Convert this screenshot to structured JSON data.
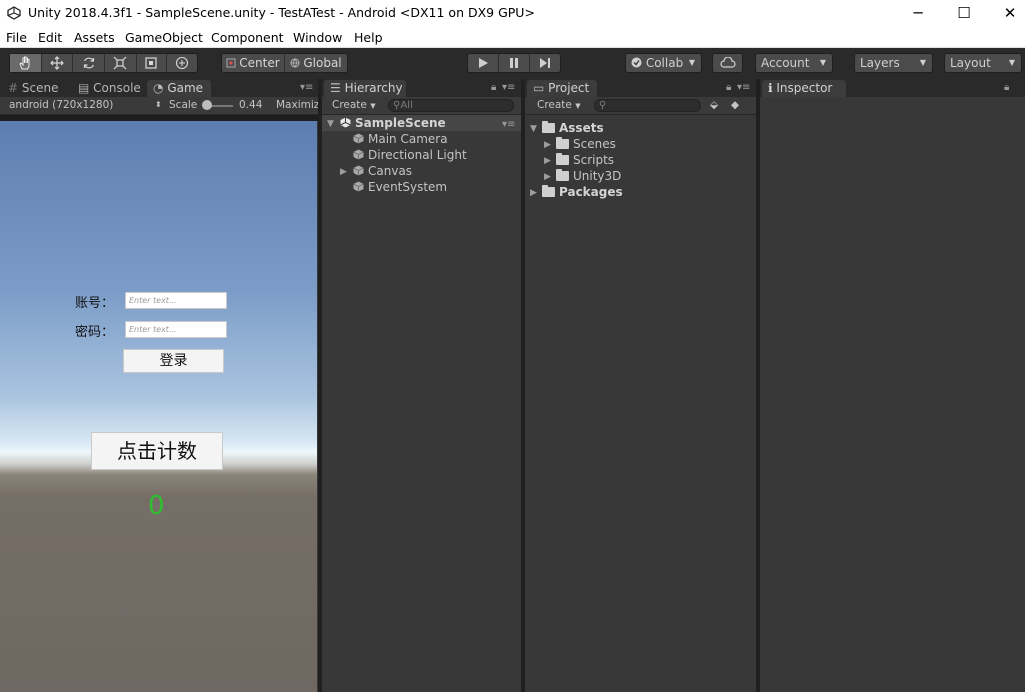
{
  "window": {
    "title": "Unity 2018.4.3f1 - SampleScene.unity - TestATest - Android <DX11 on DX9 GPU>",
    "minimize_glyph": "─",
    "maximize_glyph": "☐",
    "close_glyph": "✕"
  },
  "menu": [
    "File",
    "Edit",
    "Assets",
    "GameObject",
    "Component",
    "Window",
    "Help"
  ],
  "toolbar": {
    "pivot_label": "Center",
    "space_label": "Global",
    "collab_label": "Collab",
    "account_label": "Account",
    "layers_label": "Layers",
    "layout_label": "Layout"
  },
  "scene_panel": {
    "tabs": [
      "Scene",
      "Console",
      "Game"
    ],
    "active_tab": "Game",
    "resolution": "android (720x1280)",
    "scale_label": "Scale",
    "scale_value": "0.44",
    "maximize_label": "Maximiz"
  },
  "game": {
    "account_label": "账号：",
    "account_placeholder": "Enter text...",
    "password_label": "密码：",
    "password_placeholder": "Enter text...",
    "login_button": "登录",
    "count_button": "点击计数",
    "count_value": "0",
    "count_color": "#2fbf2f"
  },
  "hierarchy": {
    "tab": "Hierarchy",
    "create_label": "Create",
    "search_placeholder": "All",
    "scene_name": "SampleScene",
    "items": [
      "Main Camera",
      "Directional Light",
      "Canvas",
      "EventSystem"
    ]
  },
  "project": {
    "tab": "Project",
    "create_label": "Create",
    "root_assets": "Assets",
    "asset_folders": [
      "Scenes",
      "Scripts",
      "Unity3D"
    ],
    "root_packages": "Packages"
  },
  "inspector": {
    "tab": "Inspector"
  }
}
